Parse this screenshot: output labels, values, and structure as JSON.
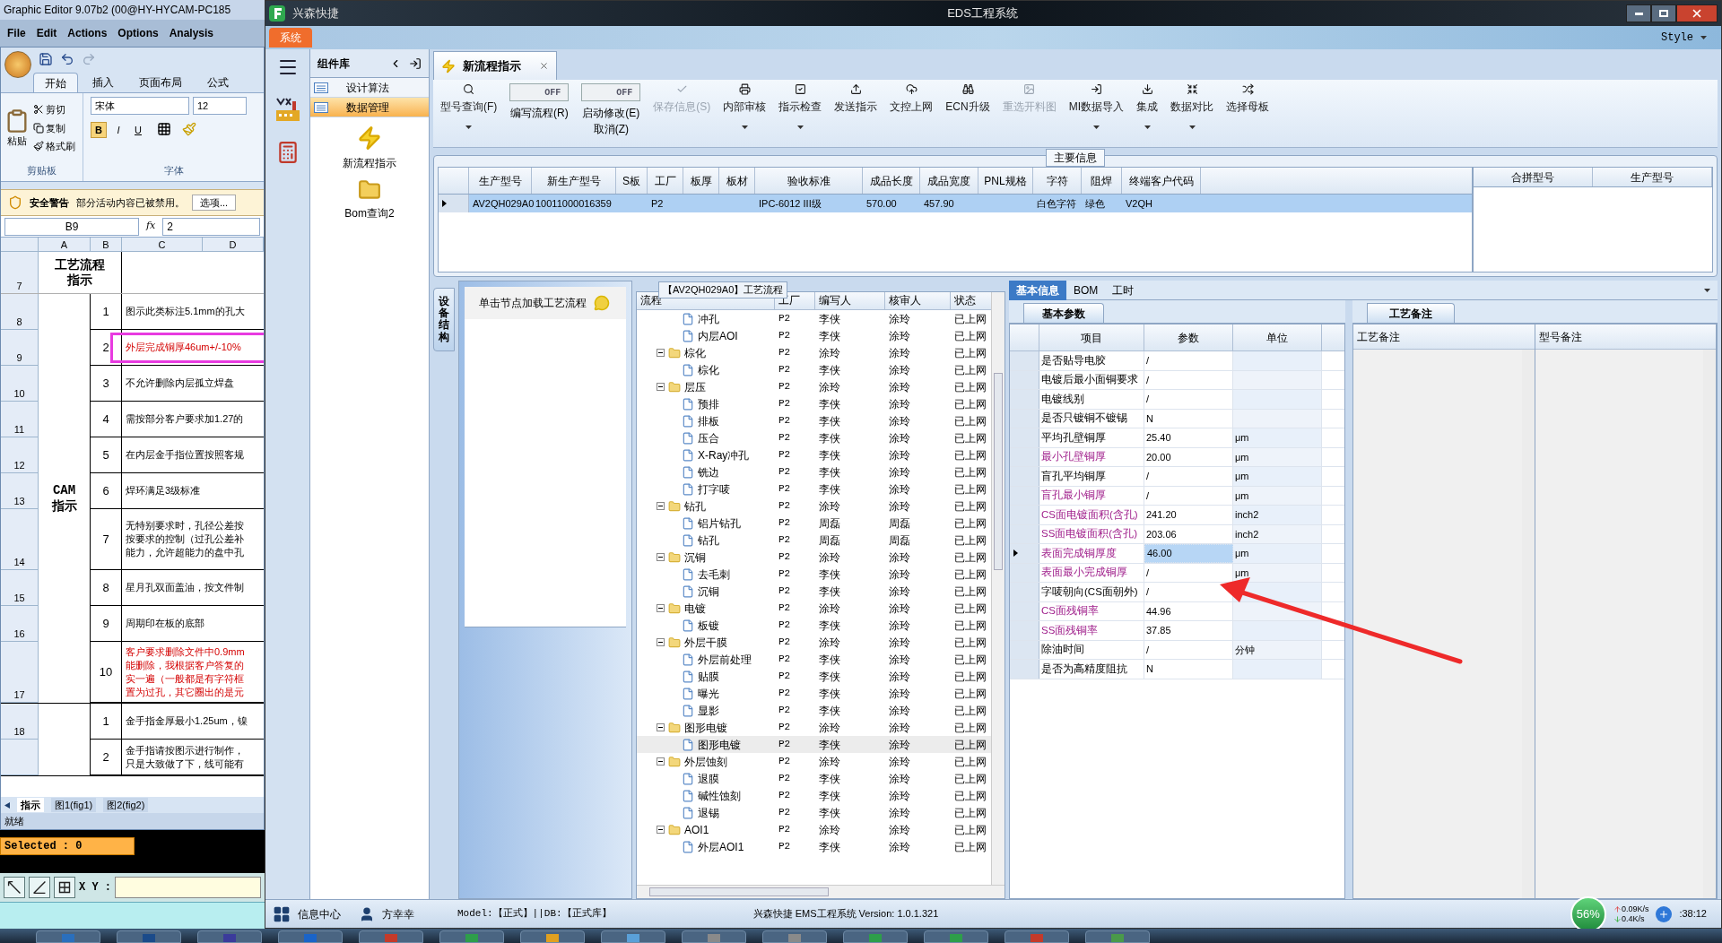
{
  "graphic_editor": {
    "title": "Graphic Editor 9.07b2 (00@HY-HYCAM-PC185",
    "menu": [
      "File",
      "Edit",
      "Actions",
      "Options",
      "Analysis"
    ],
    "selected_count": "Selected : 0",
    "xy_label": "X Y :"
  },
  "excel": {
    "ribbon_tabs": [
      {
        "label": "开始",
        "selected": true
      },
      {
        "label": "插入",
        "selected": false
      },
      {
        "label": "页面布局",
        "selected": false
      },
      {
        "label": "公式",
        "selected": false
      }
    ],
    "clipboard": {
      "paste": "粘贴",
      "cut": "剪切",
      "copy": "复制",
      "format_painter": "格式刷",
      "group": "剪贴板"
    },
    "font": {
      "name": "宋体",
      "size": "12",
      "group": "字体",
      "bold": "B",
      "italic": "I",
      "underline": "U"
    },
    "security": {
      "title": "安全警告",
      "message": "部分活动内容已被禁用。",
      "button": "选项..."
    },
    "name_box": "B9",
    "fx_label": "fx",
    "formula": "2",
    "columns": [
      "A",
      "B",
      "C",
      "D"
    ],
    "header_row": {
      "num": "7",
      "lines": [
        "工艺流程",
        "指示"
      ]
    },
    "sections": [
      {
        "lines": [
          "CAM",
          "指示"
        ],
        "rows": [
          {
            "num": "8",
            "b": "1",
            "lines": [
              "图示此类标注5.1mm的孔大"
            ],
            "highlighted": false
          },
          {
            "num": "9",
            "b": "2",
            "lines": [
              "外层完成铜厚46um+/-10%"
            ],
            "highlighted": true,
            "boxed": true
          },
          {
            "num": "10",
            "b": "3",
            "lines": [
              "不允许删除内层孤立焊盘"
            ],
            "highlighted": false
          },
          {
            "num": "11",
            "b": "4",
            "lines": [
              "需按部分客户要求加1.27的"
            ],
            "highlighted": false
          },
          {
            "num": "12",
            "b": "5",
            "lines": [
              "在内层金手指位置按照客规"
            ],
            "highlighted": false
          },
          {
            "num": "13",
            "b": "6",
            "lines": [
              "焊环满足3级标准"
            ],
            "highlighted": false
          },
          {
            "num": "14",
            "b": "7",
            "lines": [
              "无特别要求时，孔径公差按",
              "按要求的控制（过孔公差补",
              "能力，允许超能力的盘中孔"
            ],
            "highlighted": false
          },
          {
            "num": "15",
            "b": "8",
            "lines": [
              "星月孔双面盖油，按文件制"
            ],
            "highlighted": false
          },
          {
            "num": "16",
            "b": "9",
            "lines": [
              "周期印在板的底部"
            ],
            "highlighted": false
          },
          {
            "num": "17",
            "b": "10",
            "lines": [
              "客户要求删除文件中0.9mm",
              "能删除，我根据客户答复的",
              "实一遍（一般都是有字符框",
              "置为过孔，其它圈出的是元"
            ],
            "highlighted": true
          }
        ]
      },
      {
        "rows": [
          {
            "num": "18",
            "b": "1",
            "lines": [
              "金手指金厚最小1.25um，镍"
            ],
            "highlighted": false
          },
          {
            "b": "2",
            "lines": [
              "金手指请按图示进行制作，",
              "只是大致做了下，线可能有"
            ],
            "highlighted": false
          }
        ]
      }
    ],
    "sheet_tabs": [
      {
        "label": "指示",
        "selected": true
      },
      {
        "label": "图1(fig1)",
        "selected": false
      },
      {
        "label": "图2(fig2)",
        "selected": false
      }
    ],
    "status": "就绪"
  },
  "eds": {
    "app_name": "兴森快捷",
    "title": "EDS工程系统",
    "system_tab": "系统",
    "style_menu": "Style",
    "component_panel": {
      "title": "组件库",
      "items": [
        {
          "label": "设计算法",
          "selected": false
        },
        {
          "label": "数据管理",
          "selected": true
        }
      ],
      "tools": [
        {
          "kind": "lightning",
          "label": "新流程指示"
        },
        {
          "kind": "folder",
          "label": "Bom查询2"
        }
      ]
    },
    "document_tab": "新流程指示",
    "toolbar": [
      {
        "kind": "button",
        "label": "型号查询(F)",
        "dropdown": true,
        "disabled": false
      },
      {
        "kind": "toggle",
        "switch_text": "OFF",
        "on": false,
        "label": "编写流程(R)"
      },
      {
        "kind": "toggle",
        "switch_text": "OFF",
        "on": false,
        "label": "启动修改(E)",
        "sublabel": "取消(Z)"
      },
      {
        "kind": "button",
        "label": "保存信息(S)",
        "dropdown": false,
        "disabled": true
      },
      {
        "kind": "button",
        "label": "内部审核",
        "dropdown": true,
        "disabled": false
      },
      {
        "kind": "button",
        "label": "指示检查",
        "dropdown": true,
        "disabled": false
      },
      {
        "kind": "button",
        "label": "发送指示",
        "dropdown": false,
        "disabled": false
      },
      {
        "kind": "button",
        "label": "文控上网",
        "dropdown": false,
        "disabled": false
      },
      {
        "kind": "button",
        "label": "ECN升级",
        "dropdown": false,
        "disabled": false
      },
      {
        "kind": "button",
        "label": "重选开料图",
        "dropdown": false,
        "disabled": true
      },
      {
        "kind": "button",
        "label": "MI数据导入",
        "dropdown": true,
        "disabled": false
      },
      {
        "kind": "button",
        "label": "集成",
        "dropdown": true,
        "disabled": false
      },
      {
        "kind": "button",
        "label": "数据对比",
        "dropdown": true,
        "disabled": false
      },
      {
        "kind": "button",
        "label": "选择母板",
        "dropdown": false,
        "disabled": false
      }
    ],
    "main_info": {
      "title": "主要信息",
      "columns": [
        "生产型号",
        "新生产型号",
        "S板",
        "工厂",
        "板厚",
        "板材",
        "验收标准",
        "成品长度",
        "成品宽度",
        "PNL规格",
        "字符",
        "阻焊",
        "终端客户代码"
      ],
      "rows": [
        {
          "selected": true,
          "cells": [
            "AV2QH029A0",
            "10011000016359",
            null,
            "P2",
            null,
            null,
            "IPC-6012 III级",
            "570.00",
            "457.90",
            null,
            "白色字符",
            "绿色",
            "V2QH"
          ]
        }
      ],
      "side_columns": [
        "合拼型号",
        "生产型号"
      ]
    },
    "side_tab": "设备结构",
    "node_hint": "单击节点加载工艺流程",
    "process": {
      "title": "【AV2QH029A0】工艺流程",
      "columns": [
        "流程",
        "工厂",
        "编写人",
        "核审人",
        "状态"
      ],
      "nodes": [
        {
          "children": [
            {
              "label": "冲孔",
              "factory": "P2",
              "writer": "李侠",
              "reviewer": "涂玲",
              "status": "已上网",
              "selected": false
            },
            {
              "label": "内层AOI",
              "factory": "P2",
              "writer": "李侠",
              "reviewer": "涂玲",
              "status": "已上网",
              "selected": false
            }
          ]
        },
        {
          "label": "棕化",
          "factory": "P2",
          "writer": "涂玲",
          "reviewer": "涂玲",
          "status": "已上网",
          "selected": false,
          "expanded": true,
          "children": [
            {
              "label": "棕化",
              "factory": "P2",
              "writer": "李侠",
              "reviewer": "涂玲",
              "status": "已上网",
              "selected": false
            }
          ]
        },
        {
          "label": "层压",
          "factory": "P2",
          "writer": "涂玲",
          "reviewer": "涂玲",
          "status": "已上网",
          "selected": false,
          "expanded": true,
          "children": [
            {
              "label": "预排",
              "factory": "P2",
              "writer": "李侠",
              "reviewer": "涂玲",
              "status": "已上网",
              "selected": false
            },
            {
              "label": "排板",
              "factory": "P2",
              "writer": "李侠",
              "reviewer": "涂玲",
              "status": "已上网",
              "selected": false
            },
            {
              "label": "压合",
              "factory": "P2",
              "writer": "李侠",
              "reviewer": "涂玲",
              "status": "已上网",
              "selected": false
            },
            {
              "label": "X-Ray冲孔",
              "factory": "P2",
              "writer": "李侠",
              "reviewer": "涂玲",
              "status": "已上网",
              "selected": false
            },
            {
              "label": "铣边",
              "factory": "P2",
              "writer": "李侠",
              "reviewer": "涂玲",
              "status": "已上网",
              "selected": false
            },
            {
              "label": "打字唛",
              "factory": "P2",
              "writer": "李侠",
              "reviewer": "涂玲",
              "status": "已上网",
              "selected": false
            }
          ]
        },
        {
          "label": "钻孔",
          "factory": "P2",
          "writer": "涂玲",
          "reviewer": "涂玲",
          "status": "已上网",
          "selected": false,
          "expanded": true,
          "children": [
            {
              "label": "铝片钻孔",
              "factory": "P2",
              "writer": "周磊",
              "reviewer": "周磊",
              "status": "已上网",
              "selected": false
            },
            {
              "label": "钻孔",
              "factory": "P2",
              "writer": "周磊",
              "reviewer": "周磊",
              "status": "已上网",
              "selected": false
            }
          ]
        },
        {
          "label": "沉铜",
          "factory": "P2",
          "writer": "涂玲",
          "reviewer": "涂玲",
          "status": "已上网",
          "selected": false,
          "expanded": true,
          "children": [
            {
              "label": "去毛刺",
              "factory": "P2",
              "writer": "李侠",
              "reviewer": "涂玲",
              "status": "已上网",
              "selected": false
            },
            {
              "label": "沉铜",
              "factory": "P2",
              "writer": "李侠",
              "reviewer": "涂玲",
              "status": "已上网",
              "selected": false
            }
          ]
        },
        {
          "label": "电镀",
          "factory": "P2",
          "writer": "涂玲",
          "reviewer": "涂玲",
          "status": "已上网",
          "selected": false,
          "expanded": true,
          "children": [
            {
              "label": "板镀",
              "factory": "P2",
              "writer": "李侠",
              "reviewer": "涂玲",
              "status": "已上网",
              "selected": false
            }
          ]
        },
        {
          "label": "外层干膜",
          "factory": "P2",
          "writer": "涂玲",
          "reviewer": "涂玲",
          "status": "已上网",
          "selected": false,
          "expanded": true,
          "children": [
            {
              "label": "外层前处理",
              "factory": "P2",
              "writer": "李侠",
              "reviewer": "涂玲",
              "status": "已上网",
              "selected": false
            },
            {
              "label": "贴膜",
              "factory": "P2",
              "writer": "李侠",
              "reviewer": "涂玲",
              "status": "已上网",
              "selected": false
            },
            {
              "label": "曝光",
              "factory": "P2",
              "writer": "李侠",
              "reviewer": "涂玲",
              "status": "已上网",
              "selected": false
            },
            {
              "label": "显影",
              "factory": "P2",
              "writer": "李侠",
              "reviewer": "涂玲",
              "status": "已上网",
              "selected": false
            }
          ]
        },
        {
          "label": "图形电镀",
          "factory": "P2",
          "writer": "涂玲",
          "reviewer": "涂玲",
          "status": "已上网",
          "selected": false,
          "expanded": true,
          "children": [
            {
              "label": "图形电镀",
              "factory": "P2",
              "writer": "李侠",
              "reviewer": "涂玲",
              "status": "已上网",
              "selected": true
            }
          ]
        },
        {
          "label": "外层蚀刻",
          "factory": "P2",
          "writer": "涂玲",
          "reviewer": "涂玲",
          "status": "已上网",
          "selected": false,
          "expanded": true,
          "children": [
            {
              "label": "退膜",
              "factory": "P2",
              "writer": "李侠",
              "reviewer": "涂玲",
              "status": "已上网",
              "selected": false
            },
            {
              "label": "碱性蚀刻",
              "factory": "P2",
              "writer": "李侠",
              "reviewer": "涂玲",
              "status": "已上网",
              "selected": false
            },
            {
              "label": "退锡",
              "factory": "P2",
              "writer": "李侠",
              "reviewer": "涂玲",
              "status": "已上网",
              "selected": false
            }
          ]
        },
        {
          "label": "AOI1",
          "factory": "P2",
          "writer": "涂玲",
          "reviewer": "涂玲",
          "status": "已上网",
          "selected": false,
          "expanded": true,
          "children": [
            {
              "label": "外层AOI1",
              "factory": "P2",
              "writer": "李侠",
              "reviewer": "涂玲",
              "status": "已上网",
              "selected": false
            }
          ]
        }
      ]
    },
    "info_tabs": [
      {
        "label": "基本信息",
        "selected": true
      },
      {
        "label": "BOM",
        "selected": false
      },
      {
        "label": "工时",
        "selected": false
      }
    ],
    "params": {
      "tab": "基本参数",
      "columns": [
        "项目",
        "参数",
        "单位"
      ],
      "rows": [
        {
          "item": "是否贴导电胶",
          "value": "/",
          "highlighted": false,
          "selected": false
        },
        {
          "item": "电镀后最小面铜要求",
          "value": "/",
          "highlighted": false,
          "selected": false
        },
        {
          "item": "电镀线别",
          "value": "/",
          "highlighted": false,
          "selected": false
        },
        {
          "item": "是否只镀铜不镀锡",
          "value": "N",
          "highlighted": false,
          "selected": false
        },
        {
          "item": "平均孔壁铜厚",
          "value": "25.40",
          "unit": "μm",
          "highlighted": false,
          "selected": false
        },
        {
          "item": "最小孔壁铜厚",
          "value": "20.00",
          "unit": "μm",
          "highlighted": true,
          "selected": false
        },
        {
          "item": "盲孔平均铜厚",
          "value": "/",
          "unit": "μm",
          "highlighted": false,
          "selected": false
        },
        {
          "item": "盲孔最小铜厚",
          "value": "/",
          "unit": "μm",
          "highlighted": true,
          "selected": false
        },
        {
          "item": "CS面电镀面积(含孔)",
          "value": "241.20",
          "unit": "inch2",
          "highlighted": true,
          "selected": false
        },
        {
          "item": "SS面电镀面积(含孔)",
          "value": "203.06",
          "unit": "inch2",
          "highlighted": true,
          "selected": false
        },
        {
          "item": "表面完成铜厚度",
          "value": "46.00",
          "unit": "μm",
          "highlighted": true,
          "selected": true
        },
        {
          "item": "表面最小完成铜厚",
          "value": "/",
          "unit": "μm",
          "highlighted": true,
          "selected": false
        },
        {
          "item": "字唛朝向(CS面朝外)",
          "value": "/",
          "highlighted": false,
          "selected": false
        },
        {
          "item": "CS面残铜率",
          "value": "44.96",
          "highlighted": true,
          "selected": false
        },
        {
          "item": "SS面残铜率",
          "value": "37.85",
          "highlighted": true,
          "selected": false
        },
        {
          "item": "除油时间",
          "value": "/",
          "unit": "分钟",
          "highlighted": false,
          "selected": false
        },
        {
          "item": "是否为高精度阻抗",
          "value": "N",
          "highlighted": false,
          "selected": false
        }
      ]
    },
    "notes": {
      "tab": "工艺备注",
      "columns": [
        "工艺备注",
        "型号备注"
      ]
    },
    "status_bar": {
      "info_center": "信息中心",
      "user": "方幸幸",
      "model": "Model:【正式】||DB:【正式库】",
      "version": "兴森快捷 EMS工程系统 Version: 1.0.1.321",
      "cpu": "56%",
      "upload": "0.09K/s",
      "download": "0.4K/s",
      "time": ":38:12"
    }
  }
}
